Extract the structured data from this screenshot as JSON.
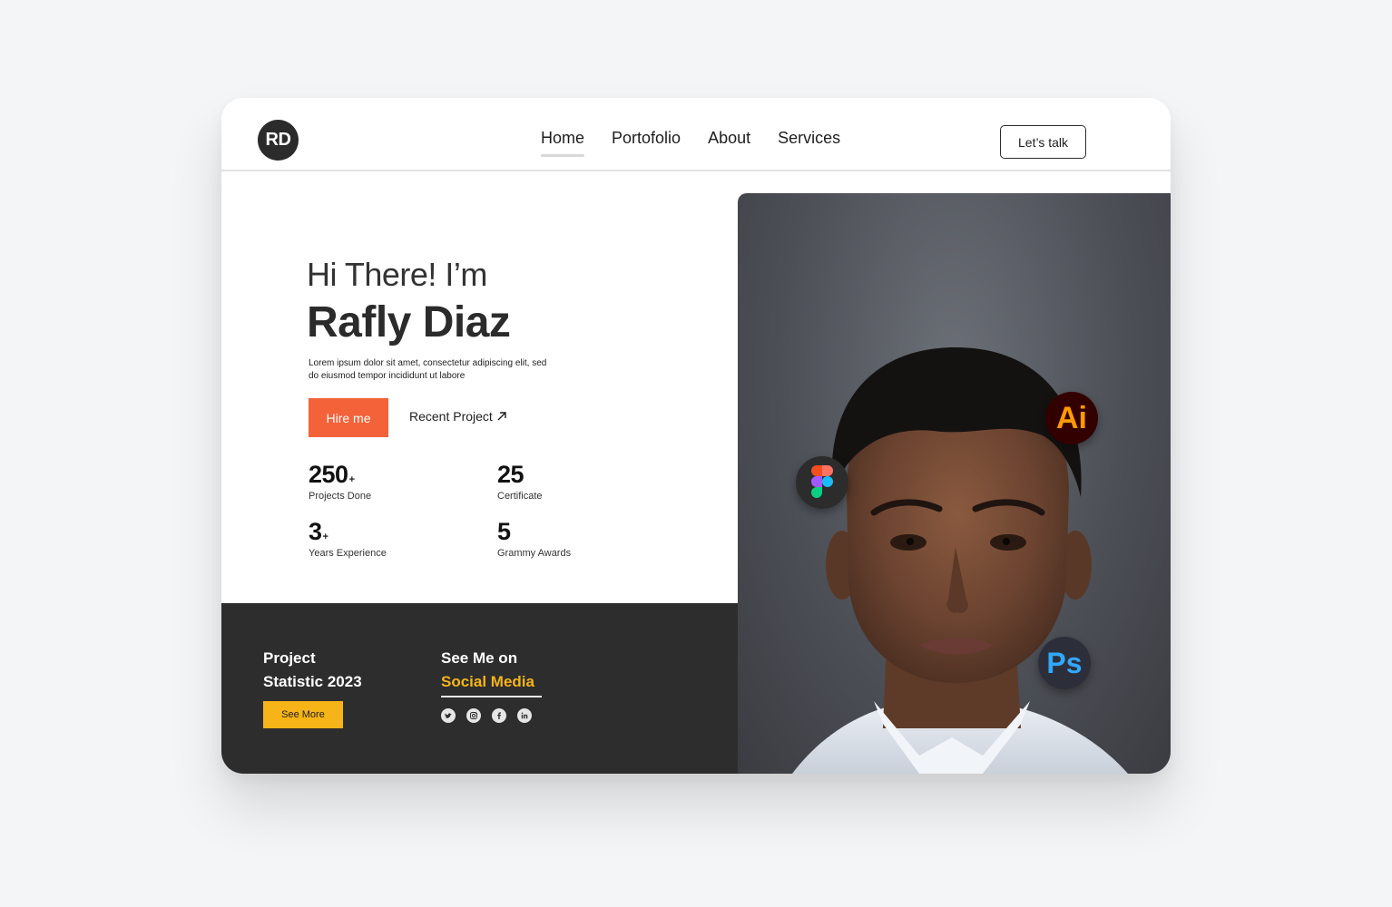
{
  "nav": {
    "logo": "RD",
    "items": [
      {
        "label": "Home",
        "active": true
      },
      {
        "label": "Portofolio",
        "active": false
      },
      {
        "label": "About",
        "active": false
      },
      {
        "label": "Services",
        "active": false
      }
    ],
    "cta": "Let’s talk"
  },
  "hero": {
    "greeting": "Hi There! I’m",
    "name": "Rafly Diaz",
    "description": "Lorem ipsum dolor sit amet, consectetur adipiscing elit, sed do eiusmod tempor incididunt ut labore",
    "hire_label": "Hire me",
    "recent_label": "Recent Project"
  },
  "stats": [
    {
      "value": "250",
      "suffix": "+",
      "label": "Projects Done"
    },
    {
      "value": "25",
      "suffix": "",
      "label": "Certificate"
    },
    {
      "value": "3",
      "suffix": "+",
      "label": "Years Experience"
    },
    {
      "value": "5",
      "suffix": "",
      "label": "Grammy Awards"
    }
  ],
  "footer": {
    "project_line1": "Project",
    "project_line2": "Statistic 2023",
    "see_more": "See More",
    "social_line1": "See Me on",
    "social_line2": "Social Media",
    "social_icons": [
      "twitter-icon",
      "instagram-icon",
      "facebook-icon",
      "linkedin-icon"
    ]
  },
  "badges": {
    "illustrator": "Ai",
    "photoshop": "Ps"
  },
  "colors": {
    "accent_orange": "#f4623a",
    "accent_yellow": "#f6b418",
    "dark": "#2d2d2d"
  }
}
